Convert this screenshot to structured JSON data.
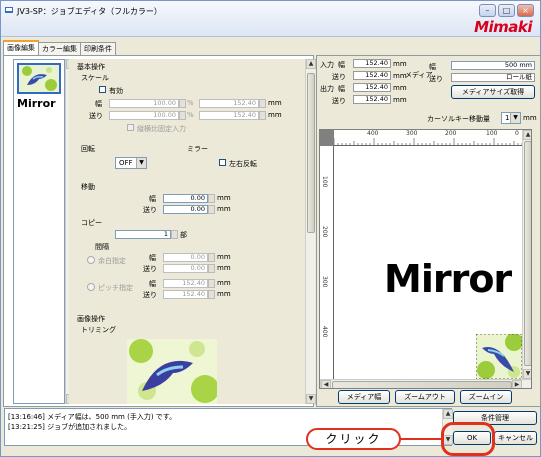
{
  "window": {
    "title": "JV3-SP：ジョブエディタ（フルカラー）",
    "logo": "Mimaki"
  },
  "tabs": [
    "画像編集",
    "カラー編集",
    "印刷条件"
  ],
  "thumbs": {
    "mirror_label": "Mirror"
  },
  "basic": {
    "section": "基本操作",
    "scale": "スケール",
    "enable": "有効",
    "width_label": "幅",
    "feed_label": "送り",
    "w_pct": "100.00",
    "w_mm": "152.40",
    "f_pct": "100.00",
    "f_mm": "152.40",
    "pct": "%",
    "mm": "mm",
    "fixed_ratio": "縦横比固定入力",
    "rotate": "回転",
    "rotate_value": "OFF",
    "mirror": "ミラー",
    "lr_flip": "左右反転",
    "move": "移動",
    "move_w": "0.00",
    "move_f": "0.00",
    "copy": "コピー",
    "copy_count": "1",
    "copy_unit": "部",
    "spacing": "間隔",
    "margin_spec": "余白指定",
    "pitch_spec": "ピッチ指定",
    "m_w": "0.00",
    "m_f": "0.00",
    "p_w": "152.40",
    "p_f": "152.40",
    "image_ops": "画像操作",
    "trimming": "トリミング"
  },
  "right": {
    "input": "入力",
    "output": "出力",
    "width": "幅",
    "feed": "送り",
    "in_w": "152.40",
    "in_f": "152.40",
    "out_w": "152.40",
    "out_f": "152.40",
    "mm": "mm",
    "media": "メディア",
    "media_w": "500 mm",
    "media_type": "ロール紙",
    "get_media": "メディアサイズ取得",
    "cursor_step": "カーソルキー移動量",
    "cursor_val": "1",
    "cursor_unit": "mm",
    "ruler_ticks": [
      "400",
      "300",
      "200",
      "100",
      "0"
    ],
    "vruler_ticks": [
      "100",
      "200",
      "300",
      "400"
    ],
    "canvas_text": "Mirror",
    "media_width_btn": "メディア幅",
    "zoom_out": "ズームアウト",
    "zoom_in": "ズームイン"
  },
  "log": {
    "lines": [
      "[13:16:46] メディア幅は、500 mm (手入力) です。",
      "[13:21:25] ジョブが追加されました。"
    ]
  },
  "buttons": {
    "cond": "条件管理",
    "ok": "OK",
    "cancel": "キャンセル"
  },
  "callout": {
    "click": "クリック"
  },
  "colors": {
    "accent": "#d8001c",
    "callout": "#e0301e"
  }
}
